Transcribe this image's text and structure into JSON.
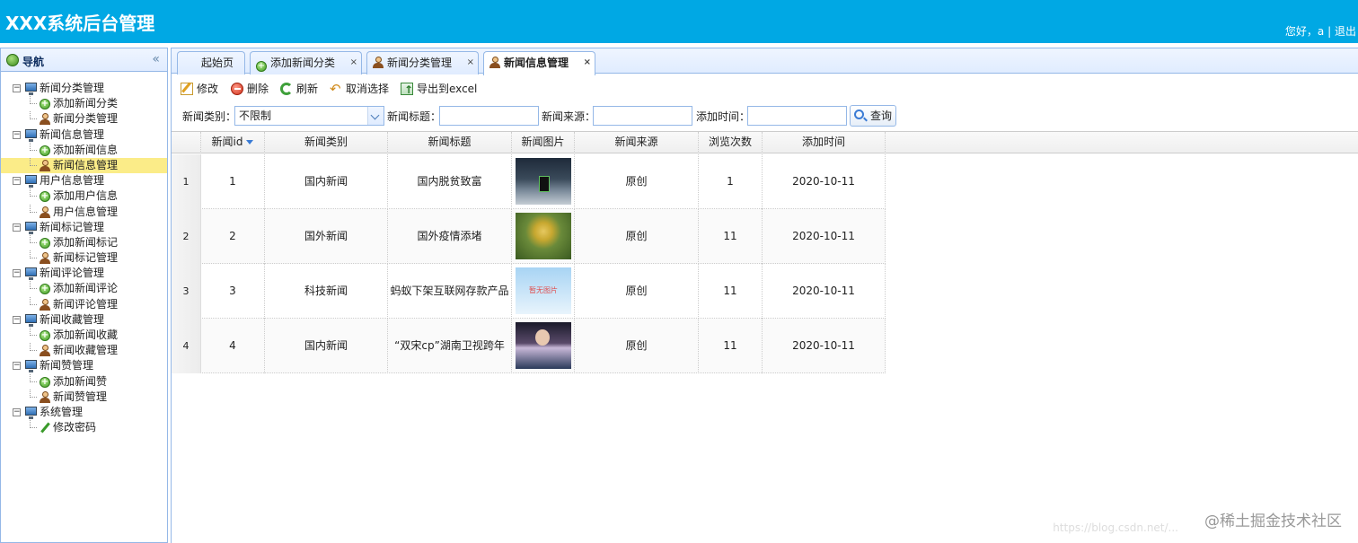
{
  "header": {
    "title": "XXX系统后台管理",
    "greeting": "您好，a",
    "separator": "|",
    "logout": "退出"
  },
  "nav": {
    "title": "导航",
    "collapse_glyph": "«",
    "groups": [
      {
        "label": "新闻分类管理",
        "items": [
          {
            "label": "添加新闻分类",
            "icon": "add-icon"
          },
          {
            "label": "新闻分类管理",
            "icon": "user-icon"
          }
        ]
      },
      {
        "label": "新闻信息管理",
        "items": [
          {
            "label": "添加新闻信息",
            "icon": "add-icon"
          },
          {
            "label": "新闻信息管理",
            "icon": "user-icon",
            "selected": true
          }
        ]
      },
      {
        "label": "用户信息管理",
        "items": [
          {
            "label": "添加用户信息",
            "icon": "add-icon"
          },
          {
            "label": "用户信息管理",
            "icon": "user-icon"
          }
        ]
      },
      {
        "label": "新闻标记管理",
        "items": [
          {
            "label": "添加新闻标记",
            "icon": "add-icon"
          },
          {
            "label": "新闻标记管理",
            "icon": "user-icon"
          }
        ]
      },
      {
        "label": "新闻评论管理",
        "items": [
          {
            "label": "添加新闻评论",
            "icon": "add-icon"
          },
          {
            "label": "新闻评论管理",
            "icon": "user-icon"
          }
        ]
      },
      {
        "label": "新闻收藏管理",
        "items": [
          {
            "label": "添加新闻收藏",
            "icon": "add-icon"
          },
          {
            "label": "新闻收藏管理",
            "icon": "user-icon"
          }
        ]
      },
      {
        "label": "新闻赞管理",
        "items": [
          {
            "label": "添加新闻赞",
            "icon": "add-icon"
          },
          {
            "label": "新闻赞管理",
            "icon": "user-icon"
          }
        ]
      },
      {
        "label": "系统管理",
        "items": [
          {
            "label": "修改密码",
            "icon": "pencil-icon"
          }
        ]
      }
    ]
  },
  "tabs": [
    {
      "label": "起始页",
      "icon": ""
    },
    {
      "label": "添加新闻分类",
      "icon": "add-icon",
      "close": "×"
    },
    {
      "label": "新闻分类管理",
      "icon": "user-icon",
      "close": "×"
    },
    {
      "label": "新闻信息管理",
      "icon": "user-icon",
      "close": "×",
      "active": true
    }
  ],
  "toolbar": {
    "edit": "修改",
    "delete": "删除",
    "refresh": "刷新",
    "cancel_select": "取消选择",
    "export": "导出到excel"
  },
  "filters": {
    "category_label": "新闻类别：",
    "category_value": "不限制",
    "title_label": "新闻标题：",
    "title_value": "",
    "source_label": "新闻来源：",
    "source_value": "",
    "time_label": "添加时间：",
    "time_value": "",
    "query": "查询"
  },
  "grid": {
    "columns": [
      "新闻id",
      "新闻类别",
      "新闻标题",
      "新闻图片",
      "新闻来源",
      "浏览次数",
      "添加时间"
    ],
    "rows": [
      {
        "num": "1",
        "id": "1",
        "category": "国内新闻",
        "title": "国内脱贫致富",
        "image": "t1",
        "image_text": "",
        "source": "原创",
        "views": "1",
        "time": "2020-10-11"
      },
      {
        "num": "2",
        "id": "2",
        "category": "国外新闻",
        "title": "国外疫情添堵",
        "image": "t2",
        "image_text": "",
        "source": "原创",
        "views": "11",
        "time": "2020-10-11"
      },
      {
        "num": "3",
        "id": "3",
        "category": "科技新闻",
        "title": "蚂蚁下架互联网存款产品",
        "image": "t3",
        "image_text": "暂无图片",
        "source": "原创",
        "views": "11",
        "time": "2020-10-11"
      },
      {
        "num": "4",
        "id": "4",
        "category": "国内新闻",
        "title": "“双宋cp”湖南卫视跨年",
        "image": "t4",
        "image_text": "",
        "source": "原创",
        "views": "11",
        "time": "2020-10-11"
      }
    ]
  },
  "watermark": "@稀土掘金技术社区",
  "watermark_url": "https://blog.csdn.net/..."
}
